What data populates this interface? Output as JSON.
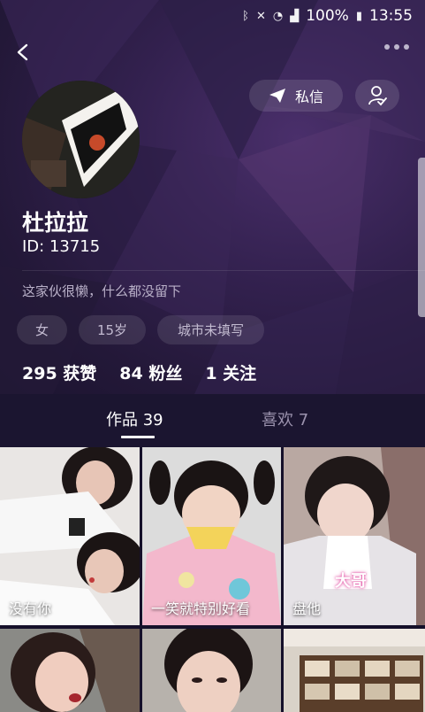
{
  "status_bar": {
    "battery": "100%",
    "time": "13:55",
    "icons": [
      "bluetooth-icon",
      "mute-icon",
      "wifi-icon",
      "signal-icon",
      "battery-icon"
    ]
  },
  "profile": {
    "name": "杜拉拉",
    "id_text": "ID: 13715",
    "bio": "这家伙很懒，什么都没留下",
    "tags": [
      "女",
      "15岁",
      "城市未填写"
    ],
    "stats": [
      "295 获赞",
      "84 粉丝",
      "1 关注"
    ]
  },
  "actions": {
    "private_message": "私信"
  },
  "tabs": {
    "works": "作品 39",
    "likes": "喜欢 7"
  },
  "grid": {
    "captions": [
      "没有你",
      "一笑就特别好看",
      "盘他"
    ],
    "overlay_text": "大哥"
  },
  "colors": {
    "header_bg": "#2b1d45",
    "accent_overlay": "#e35aa8"
  }
}
